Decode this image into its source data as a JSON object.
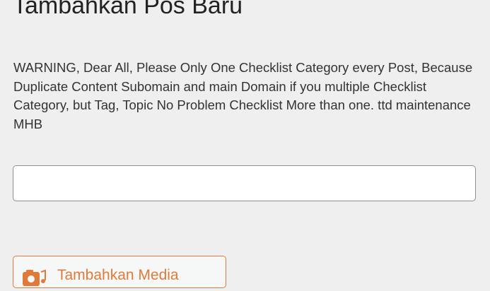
{
  "page": {
    "title": "Tambahkan Pos Baru"
  },
  "notice": {
    "text": "WARNING, Dear All, Please Only One Checklist Category every Post, Because Duplicate Content Subomain and main Domain if you multiple Checklist Category, but Tag, Topic No Problem Checklist More than one. ttd maintenance MHB"
  },
  "title_input": {
    "value": "",
    "placeholder": ""
  },
  "media": {
    "button_label": "Tambahkan Media",
    "icon": "camera-music-icon",
    "accent_color": "#e07a3a"
  }
}
